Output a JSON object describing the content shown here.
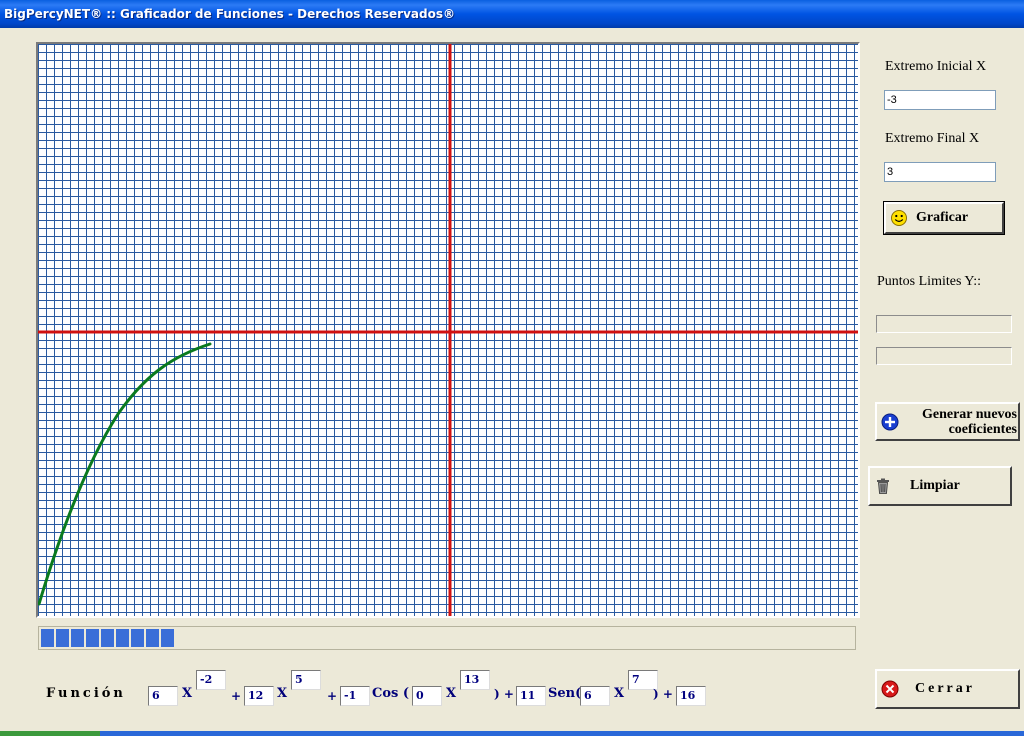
{
  "window": {
    "title": "BigPercyNET® :: Graficador de Funciones - Derechos Reservados®"
  },
  "controls": {
    "x_start_label": "Extremo Inicial X",
    "x_start_value": "-3",
    "x_end_label": "Extremo Final X",
    "x_end_value": "3",
    "graph_button": "Graficar",
    "y_limits_label": "Puntos Limites Y::",
    "y_limit_1": "",
    "y_limit_2": "",
    "new_coeffs_line1": "Generar nuevos",
    "new_coeffs_line2": "coeficientes",
    "clear_button": "Limpiar",
    "close_button": "Cerrar"
  },
  "progress": {
    "fraction": 0.165
  },
  "function": {
    "label": "Función",
    "x_symbol": "X",
    "plus": "+",
    "cos": "Cos (",
    "close_paren_plus": ") +",
    "sen": "Sen(",
    "coef1": "6",
    "exp1": "-2",
    "coef2": "12",
    "exp2": "5",
    "coef3": "-1",
    "cos_coef": "0",
    "cos_exp": "13",
    "coef4": "11",
    "sen_coef": "6",
    "sen_exp": "7",
    "const": "16"
  },
  "colors": {
    "grid": "#2a5aa0",
    "axes": "#d01010",
    "curve": "#0a7a1e",
    "titlebar": "#0054e3"
  },
  "icons": {
    "graph_button": "smiley-icon",
    "new_coeffs": "plus-circle-icon",
    "clear": "trash-can-icon",
    "close": "close-circle-icon"
  }
}
